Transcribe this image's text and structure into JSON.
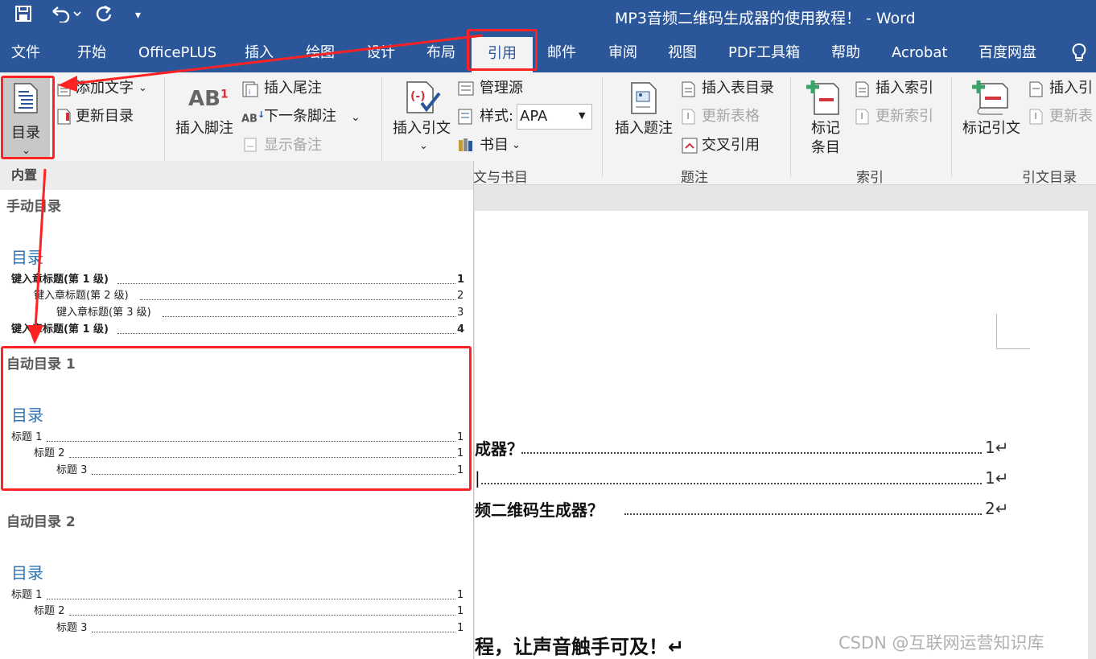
{
  "window": {
    "title": "MP3音频二维码生成器的使用教程！  -  Word"
  },
  "tabs": [
    "文件",
    "开始",
    "OfficePLUS",
    "插入",
    "绘图",
    "设计",
    "布局",
    "引用",
    "邮件",
    "审阅",
    "视图",
    "PDF工具箱",
    "帮助",
    "Acrobat",
    "百度网盘"
  ],
  "ribbon": {
    "toc": {
      "button": "目录",
      "add_text": "添加文字",
      "update": "更新目录"
    },
    "footnotes": {
      "insert_footnote": "插入脚注",
      "insert_endnote": "插入尾注",
      "next_footnote": "下一条脚注",
      "show_notes": "显示备注"
    },
    "citations": {
      "insert_citation": "插入引文",
      "manage_sources": "管理源",
      "style_label": "样式:",
      "style_value": "APA",
      "bibliography": "书目",
      "group": "引文与书目",
      "group_visible": "文与书目"
    },
    "captions": {
      "insert_caption": "插入题注",
      "insert_table_of_figures": "插入表目录",
      "update_table": "更新表格",
      "cross_reference": "交叉引用",
      "group": "题注"
    },
    "index": {
      "mark_entry_1": "标记",
      "mark_entry_2": "条目",
      "insert_index": "插入索引",
      "update_index": "更新索引",
      "group": "索引"
    },
    "toa": {
      "mark_citation": "标记引文",
      "insert_toa": "插入引",
      "update_toa": "更新表",
      "group": "引文目录"
    }
  },
  "dropdown": {
    "header": "内置",
    "manual": {
      "title": "手动目录",
      "heading": "目录",
      "rows": [
        {
          "text": "键入章标题(第  1  级)",
          "page": "1"
        },
        {
          "text": "键入章标题(第  2  级)",
          "page": "2"
        },
        {
          "text": "键入章标题(第  3  级)",
          "page": "3"
        },
        {
          "text": "键入章标题(第  1  级)",
          "page": "4"
        }
      ]
    },
    "auto1": {
      "title": "自动目录 1",
      "heading": "目录",
      "rows": [
        {
          "text": "标题  1",
          "page": "1"
        },
        {
          "text": "标题  2",
          "page": "1"
        },
        {
          "text": "标题  3",
          "page": "1"
        }
      ]
    },
    "auto2": {
      "title": "自动目录 2",
      "heading": "目录",
      "rows": [
        {
          "text": "标题  1",
          "page": "1"
        },
        {
          "text": "标题  2",
          "page": "1"
        },
        {
          "text": "标题  3",
          "page": "1"
        }
      ]
    }
  },
  "document": {
    "toc_lines": [
      {
        "text": "成器？",
        "page": "1↵"
      },
      {
        "text": "|",
        "page": "1↵"
      },
      {
        "text": "频二维码生成器？",
        "page": "2↵"
      }
    ],
    "bottom_text": "程，让声音触手可及！↵"
  },
  "watermark": "CSDN @互联网运营知识库",
  "colors": {
    "accent": "#2b579a",
    "highlight": "#ff2222",
    "heading": "#2e74b5"
  }
}
